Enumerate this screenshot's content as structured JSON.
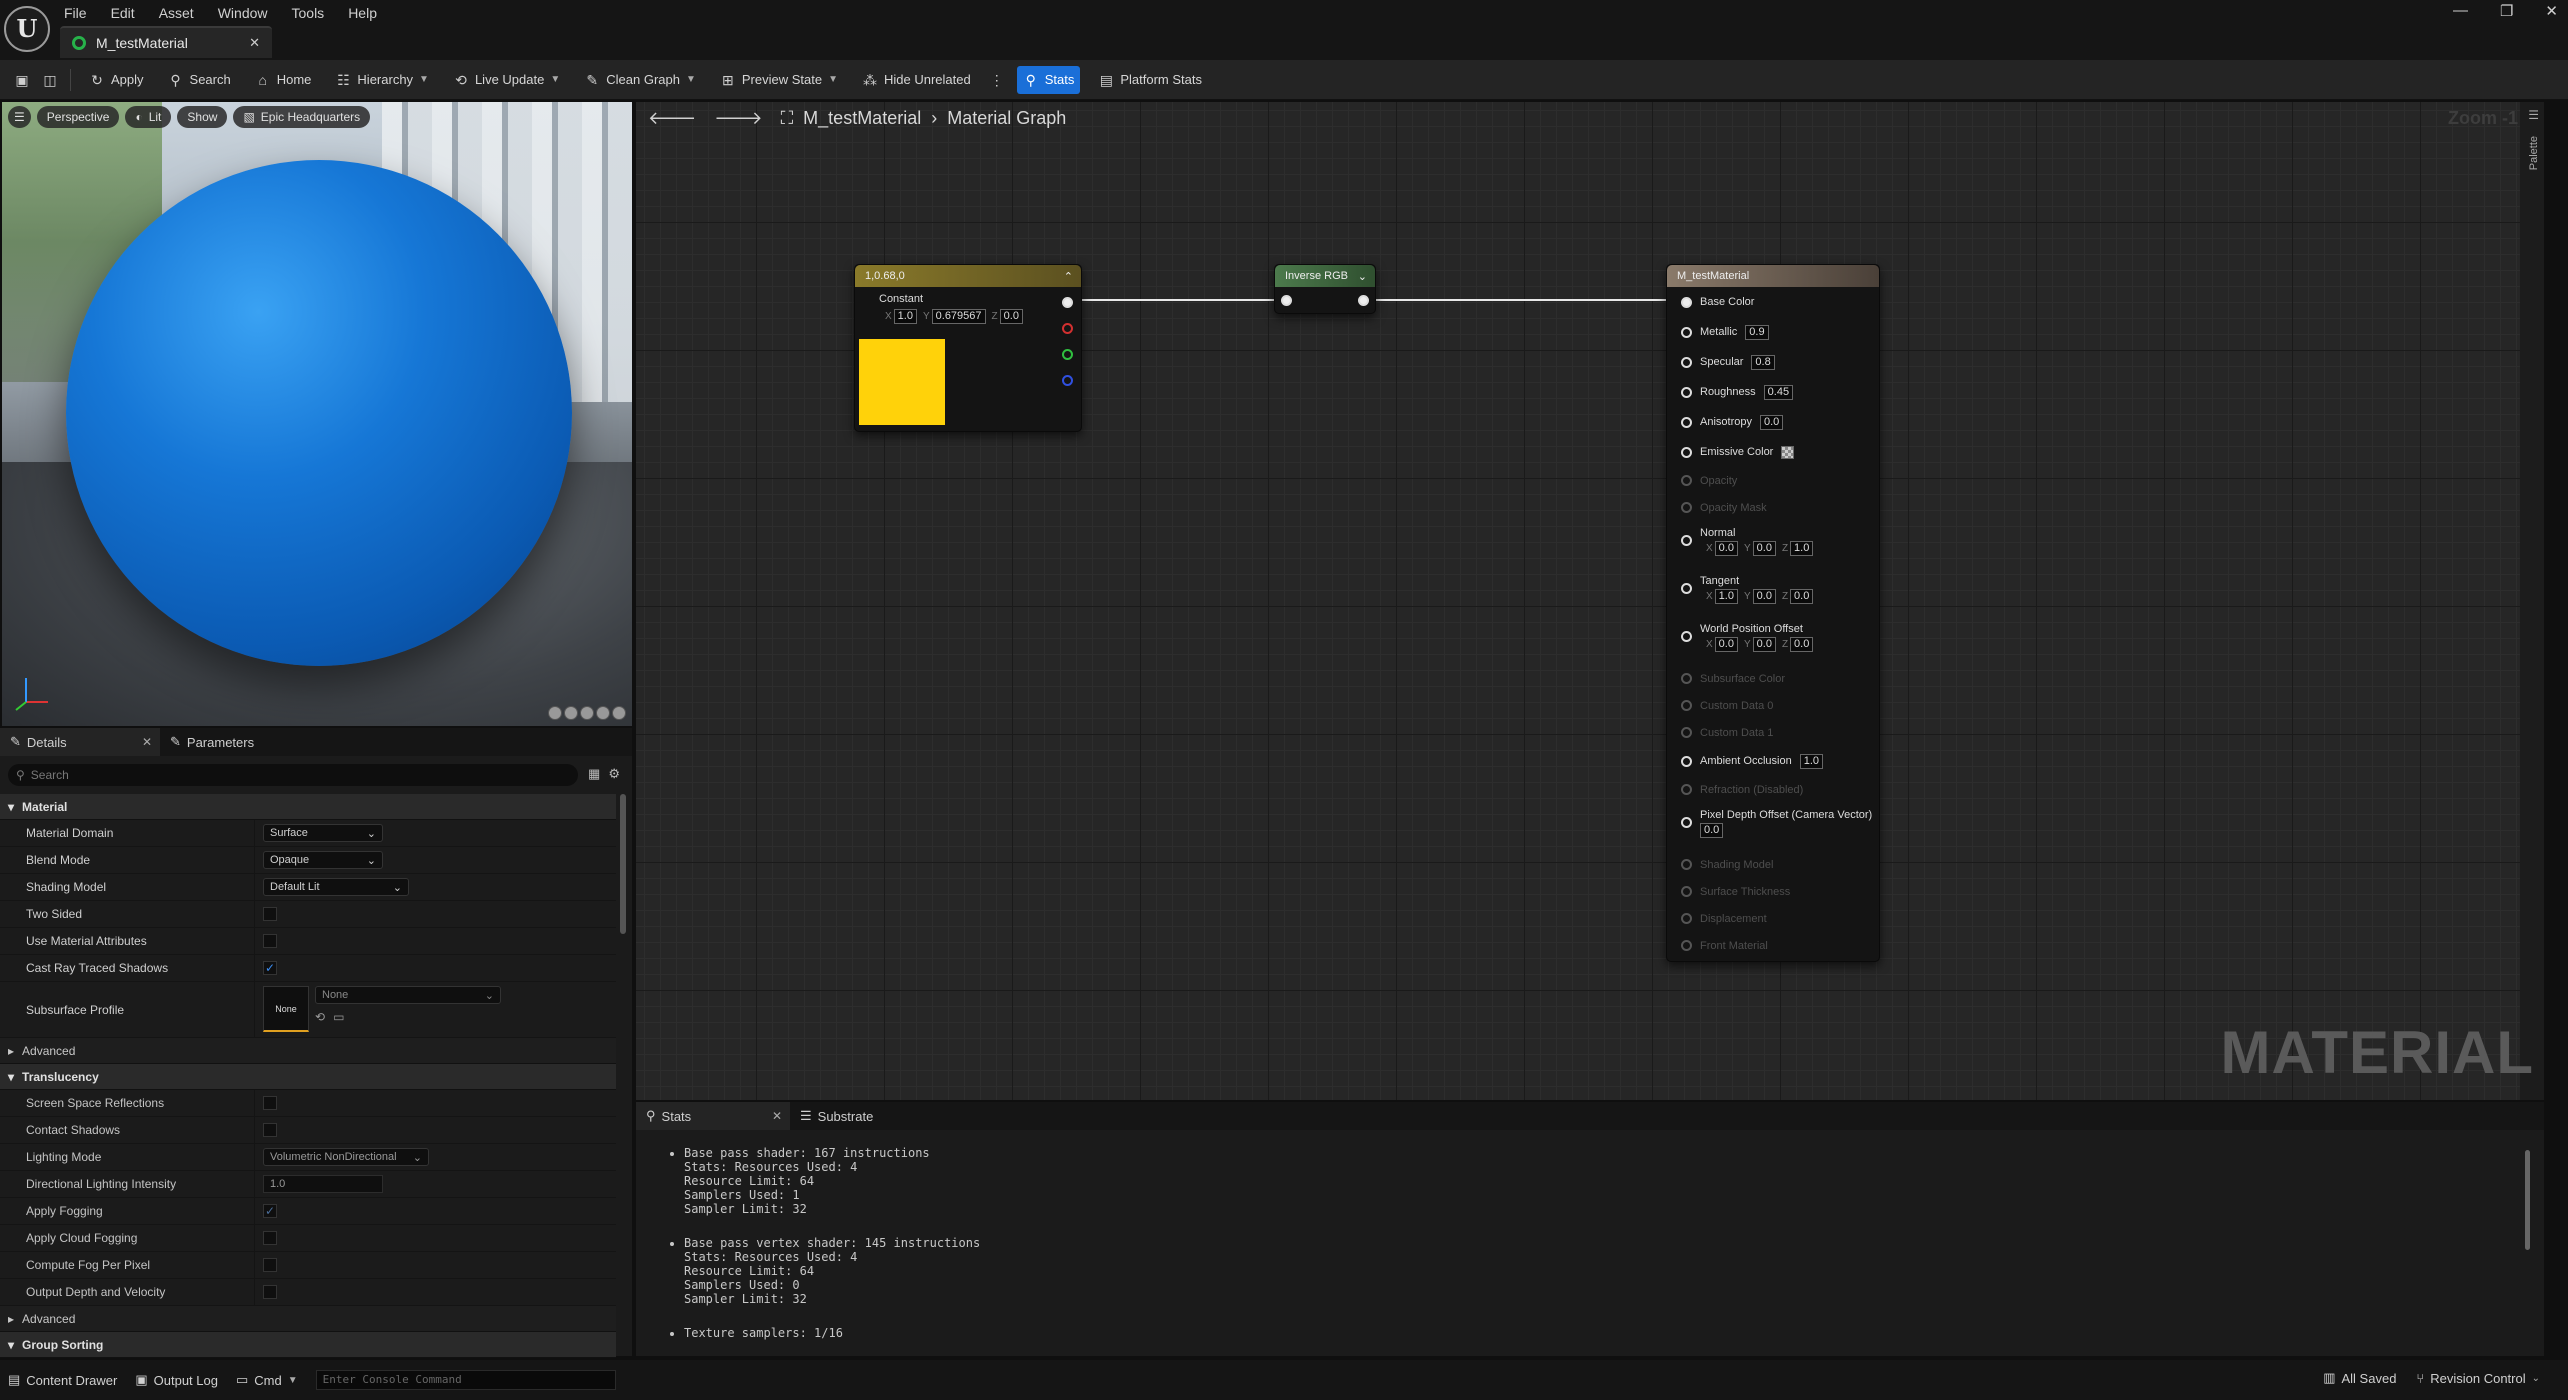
{
  "menu": [
    "File",
    "Edit",
    "Asset",
    "Window",
    "Tools",
    "Help"
  ],
  "document_tab": "M_testMaterial",
  "toolbar": {
    "apply": "Apply",
    "search": "Search",
    "home": "Home",
    "hierarchy": "Hierarchy",
    "live_update": "Live Update",
    "clean_graph": "Clean Graph",
    "preview_state": "Preview State",
    "hide_unrelated": "Hide Unrelated",
    "stats": "Stats",
    "platform_stats": "Platform Stats"
  },
  "viewport": {
    "perspective": "Perspective",
    "lit": "Lit",
    "show": "Show",
    "environment": "Epic Headquarters"
  },
  "details": {
    "tab_details": "Details",
    "tab_parameters": "Parameters",
    "search_placeholder": "Search",
    "categories": {
      "material": "Material",
      "advanced": "Advanced",
      "translucency": "Translucency",
      "advanced2": "Advanced",
      "group_sorting": "Group Sorting"
    },
    "material_domain": {
      "label": "Material Domain",
      "value": "Surface"
    },
    "blend_mode": {
      "label": "Blend Mode",
      "value": "Opaque"
    },
    "shading_model": {
      "label": "Shading Model",
      "value": "Default Lit"
    },
    "two_sided": {
      "label": "Two Sided"
    },
    "use_material_attributes": {
      "label": "Use Material Attributes"
    },
    "cast_ray_traced_shadows": {
      "label": "Cast Ray Traced Shadows",
      "checked": true
    },
    "subsurface_profile": {
      "label": "Subsurface Profile",
      "value": "None",
      "thumb": "None"
    },
    "screen_space_reflections": {
      "label": "Screen Space Reflections"
    },
    "contact_shadows": {
      "label": "Contact Shadows"
    },
    "lighting_mode": {
      "label": "Lighting Mode",
      "value": "Volumetric NonDirectional"
    },
    "directional_lighting_intensity": {
      "label": "Directional Lighting Intensity",
      "value": "1.0"
    },
    "apply_fogging": {
      "label": "Apply Fogging",
      "checked": true
    },
    "apply_cloud_fogging": {
      "label": "Apply Cloud Fogging"
    },
    "compute_fog_per_pixel": {
      "label": "Compute Fog Per Pixel"
    },
    "output_depth_velocity": {
      "label": "Output Depth and Velocity"
    }
  },
  "graph": {
    "breadcrumb_root": "M_testMaterial",
    "breadcrumb_leaf": "Material Graph",
    "zoom": "Zoom -1",
    "palette": "Palette",
    "watermark": "MATERIAL",
    "constant_node": {
      "title": "1,0.68,0",
      "label": "Constant",
      "x_label": "X",
      "x": "1.0",
      "y_label": "Y",
      "y": "0.679567",
      "z_label": "Z",
      "z": "0.0",
      "color": "#ffd20a"
    },
    "inverse_node": {
      "title": "Inverse RGB"
    },
    "material_node": {
      "title": "M_testMaterial",
      "base_color": "Base Color",
      "metallic": {
        "label": "Metallic",
        "value": "0.9"
      },
      "specular": {
        "label": "Specular",
        "value": "0.8"
      },
      "roughness": {
        "label": "Roughness",
        "value": "0.45"
      },
      "anisotropy": {
        "label": "Anisotropy",
        "value": "0.0"
      },
      "emissive": "Emissive Color",
      "opacity": "Opacity",
      "opacity_mask": "Opacity Mask",
      "normal": {
        "label": "Normal",
        "x": "0.0",
        "y": "0.0",
        "z": "1.0"
      },
      "tangent": {
        "label": "Tangent",
        "x": "1.0",
        "y": "0.0",
        "z": "0.0"
      },
      "wpo": {
        "label": "World Position Offset",
        "x": "0.0",
        "y": "0.0",
        "z": "0.0"
      },
      "subsurface_color": "Subsurface Color",
      "custom_data_0": "Custom Data 0",
      "custom_data_1": "Custom Data 1",
      "ambient_occlusion": {
        "label": "Ambient Occlusion",
        "value": "1.0"
      },
      "refraction": "Refraction (Disabled)",
      "pixel_depth_offset": {
        "label": "Pixel Depth Offset (Camera Vector)",
        "value": "0.0"
      },
      "shading_model": "Shading Model",
      "surface_thickness": "Surface Thickness",
      "displacement": "Displacement",
      "front_material": "Front Material"
    }
  },
  "stats": {
    "tab_stats": "Stats",
    "tab_substrate": "Substrate",
    "block1": "Base pass shader: 167 instructions\nStats: Resources Used: 4\nResource Limit: 64\nSamplers Used: 1\nSampler Limit: 32",
    "block2": "Base pass vertex shader: 145 instructions\nStats: Resources Used: 4\nResource Limit: 64\nSamplers Used: 0\nSampler Limit: 32",
    "block3": "Texture samplers: 1/16"
  },
  "statusbar": {
    "content_drawer": "Content Drawer",
    "output_log": "Output Log",
    "cmd": "Cmd",
    "console_placeholder": "Enter Console Command",
    "all_saved": "All Saved",
    "revision_control": "Revision Control"
  }
}
